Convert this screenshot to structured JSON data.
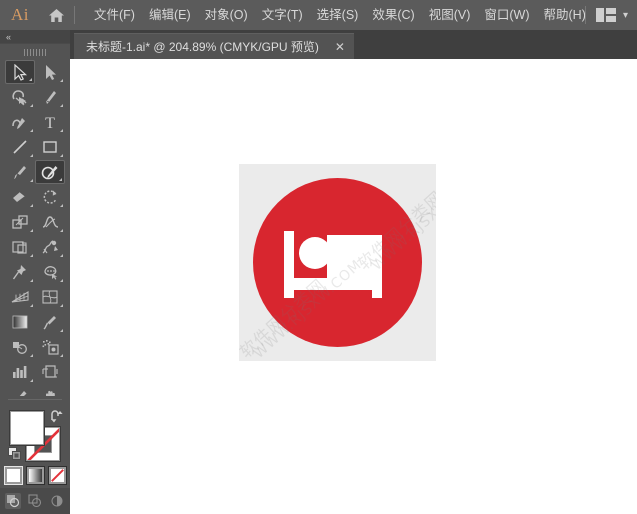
{
  "app": {
    "name": "Ai",
    "logo_color": "#d79b63"
  },
  "menubar": {
    "home_icon": "home-icon",
    "items": [
      {
        "label": "文件(F)"
      },
      {
        "label": "编辑(E)"
      },
      {
        "label": "对象(O)"
      },
      {
        "label": "文字(T)"
      },
      {
        "label": "选择(S)"
      },
      {
        "label": "效果(C)"
      },
      {
        "label": "视图(V)"
      },
      {
        "label": "窗口(W)"
      },
      {
        "label": "帮助(H)"
      }
    ],
    "workspace_icon": "workspace-layout-icon",
    "workspace_chevron": "▾"
  },
  "tabbar": {
    "tab_title": "未标题-1.ai* @ 204.89% (CMYK/GPU 预览)",
    "close_label": "✕"
  },
  "toolbar": {
    "collapse_label": "«",
    "tools": [
      {
        "name": "selection-tool",
        "icon": "arrow-solid-outline",
        "active": true,
        "corner": true
      },
      {
        "name": "direct-selection-tool",
        "icon": "arrow-filled",
        "active": false,
        "corner": true
      },
      {
        "name": "magic-wand-tool",
        "icon": "magic-wand",
        "active": false,
        "corner": true
      },
      {
        "name": "pen-tool",
        "icon": "pen",
        "active": false,
        "corner": true
      },
      {
        "name": "curvature-tool",
        "icon": "curvature",
        "active": false,
        "corner": true
      },
      {
        "name": "type-tool",
        "icon": "type-T",
        "active": false,
        "corner": true
      },
      {
        "name": "line-segment-tool",
        "icon": "line-diagonal",
        "active": false,
        "corner": true
      },
      {
        "name": "rectangle-tool",
        "icon": "rectangle",
        "active": false,
        "corner": true
      },
      {
        "name": "paintbrush-tool",
        "icon": "paintbrush",
        "active": false,
        "corner": true
      },
      {
        "name": "shaper-tool",
        "icon": "shaper-pencil",
        "active": true,
        "corner": true
      },
      {
        "name": "eraser-tool",
        "icon": "eraser",
        "active": false,
        "corner": true
      },
      {
        "name": "rotate-tool",
        "icon": "rotate",
        "active": false,
        "corner": true
      },
      {
        "name": "scale-tool",
        "icon": "scale",
        "active": false,
        "corner": true
      },
      {
        "name": "width-tool",
        "icon": "width-warp",
        "active": false,
        "corner": true
      },
      {
        "name": "free-transform-tool",
        "icon": "free-transform",
        "active": false,
        "corner": true
      },
      {
        "name": "shape-builder-tool",
        "icon": "shape-builder",
        "active": false,
        "corner": true
      },
      {
        "name": "perspective-grid-tool",
        "icon": "perspective-grid",
        "active": false,
        "corner": true
      },
      {
        "name": "mesh-tool",
        "icon": "mesh",
        "active": false,
        "corner": true
      },
      {
        "name": "gradient-tool",
        "icon": "gradient",
        "active": false,
        "corner": false
      },
      {
        "name": "eyedropper-tool",
        "icon": "eyedropper",
        "active": false,
        "corner": true
      },
      {
        "name": "blend-tool",
        "icon": "blend",
        "active": false,
        "corner": true
      },
      {
        "name": "symbol-sprayer-tool",
        "icon": "symbol-sprayer",
        "active": false,
        "corner": true
      },
      {
        "name": "column-graph-tool",
        "icon": "bar-graph",
        "active": false,
        "corner": true
      },
      {
        "name": "artboard-tool",
        "icon": "artboard",
        "active": false,
        "corner": false
      },
      {
        "name": "slice-tool",
        "icon": "slice-knife",
        "active": false,
        "corner": true
      },
      {
        "name": "hand-tool",
        "icon": "hand",
        "active": false,
        "corner": true
      },
      {
        "name": "zoom-tool",
        "icon": "magnifier",
        "active": false,
        "corner": false
      }
    ],
    "color": {
      "fill_color": "#ffffff",
      "stroke_color": "#ffffff",
      "stroke_is_none": true,
      "swap_icon": "swap-fill-stroke-icon",
      "default_icon": "default-fill-stroke-icon",
      "modes": [
        {
          "name": "color-mode",
          "selected": true,
          "swatch": "#ffffff"
        },
        {
          "name": "gradient-mode",
          "selected": false,
          "swatch": "gradient"
        },
        {
          "name": "none-mode",
          "selected": false,
          "swatch": "none"
        }
      ],
      "draw_modes": [
        {
          "name": "draw-normal-mode",
          "selected": true
        },
        {
          "name": "draw-behind-mode",
          "selected": false
        },
        {
          "name": "draw-inside-mode",
          "selected": false
        }
      ]
    }
  },
  "canvas": {
    "background": "#ffffff",
    "artwork": {
      "name": "no-sleeping-bed-sign",
      "board_color": "#ebebeb",
      "circle_color": "#d8262f",
      "icon_color": "#ffffff",
      "description": "red circle with white bed pictogram"
    },
    "watermark": {
      "line1": "软件网分类网",
      "line2": "WWW.RJSXW.COM",
      "color": "rgba(120,120,120,0.16)"
    }
  }
}
